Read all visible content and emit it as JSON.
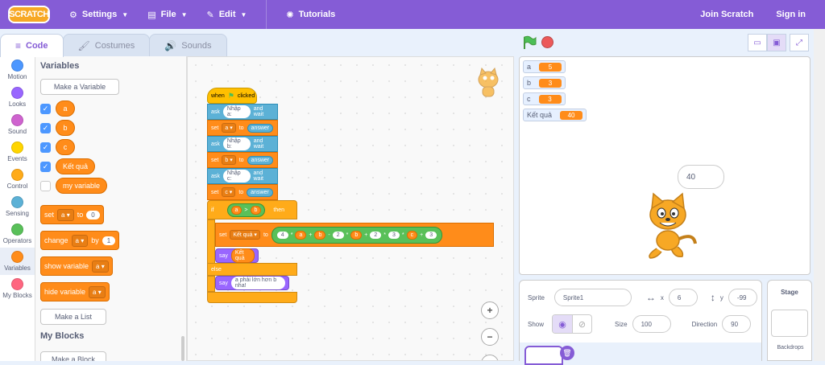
{
  "menubar": {
    "logo": "SCRATCH",
    "settings": "Settings",
    "file": "File",
    "edit": "Edit",
    "tutorials": "Tutorials",
    "join": "Join Scratch",
    "signin": "Sign in"
  },
  "tabs": {
    "code": "Code",
    "costumes": "Costumes",
    "sounds": "Sounds"
  },
  "categories": [
    {
      "label": "Motion",
      "color": "#4c97ff"
    },
    {
      "label": "Looks",
      "color": "#9966ff"
    },
    {
      "label": "Sound",
      "color": "#cf63cf"
    },
    {
      "label": "Events",
      "color": "#ffd500"
    },
    {
      "label": "Control",
      "color": "#ffab19"
    },
    {
      "label": "Sensing",
      "color": "#5cb1d6"
    },
    {
      "label": "Operators",
      "color": "#59c059"
    },
    {
      "label": "Variables",
      "color": "#ff8c1a"
    },
    {
      "label": "My Blocks",
      "color": "#ff6680"
    }
  ],
  "palette": {
    "heading_vars": "Variables",
    "make_var": "Make a Variable",
    "vars": [
      "a",
      "b",
      "c",
      "Kết quả",
      "my variable"
    ],
    "set_block": {
      "verb": "set",
      "var": "a",
      "to": "to",
      "val": "0"
    },
    "change_block": {
      "verb": "change",
      "var": "a",
      "by": "by",
      "val": "1"
    },
    "show_block": {
      "verb": "show variable",
      "var": "a"
    },
    "hide_block": {
      "verb": "hide variable",
      "var": "a"
    },
    "make_list": "Make a List",
    "heading_myblocks": "My Blocks",
    "make_block": "Make a Block"
  },
  "script": {
    "hat": {
      "when": "when",
      "clicked": "clicked"
    },
    "ask1": {
      "ask": "ask",
      "q": "Nhập a:",
      "wait": "and wait"
    },
    "set1": {
      "set": "set",
      "var": "a",
      "to": "to",
      "rep": "answer"
    },
    "ask2": {
      "ask": "ask",
      "q": "Nhập b:",
      "wait": "and wait"
    },
    "set2": {
      "set": "set",
      "var": "b",
      "to": "to",
      "rep": "answer"
    },
    "ask3": {
      "ask": "ask",
      "q": "Nhập c:",
      "wait": "and wait"
    },
    "set3": {
      "set": "set",
      "var": "c",
      "to": "to",
      "rep": "answer"
    },
    "if": {
      "if": "if",
      "left": "a",
      "op": ">",
      "right": "b",
      "then": "then"
    },
    "set4": {
      "set": "set",
      "var": "Kết quả",
      "to": "to"
    },
    "expr": [
      "4",
      "*",
      "a",
      "+",
      "b",
      "-",
      "2",
      "*",
      "b",
      "+",
      "2",
      "*",
      "3",
      "*",
      "c",
      "+",
      "3"
    ],
    "say1": {
      "say": "say",
      "val": "Kết quả"
    },
    "else": "else",
    "say2": {
      "say": "say",
      "val": "a phải lớn hơn b nha!"
    }
  },
  "zoom": {
    "in": "+",
    "out": "−"
  },
  "monitors": [
    {
      "name": "a",
      "value": "5"
    },
    {
      "name": "b",
      "value": "3"
    },
    {
      "name": "c",
      "value": "3"
    },
    {
      "name": "Kết quả",
      "value": "40"
    }
  ],
  "bubble": "40",
  "sprite_info": {
    "sprite_label": "Sprite",
    "sprite_name": "Sprite1",
    "x_label": "x",
    "x": "6",
    "y_label": "y",
    "y": "-99",
    "show_label": "Show",
    "size_label": "Size",
    "size": "100",
    "direction_label": "Direction",
    "direction": "90"
  },
  "stage_panel": {
    "label": "Stage",
    "backdrops": "Backdrops"
  }
}
